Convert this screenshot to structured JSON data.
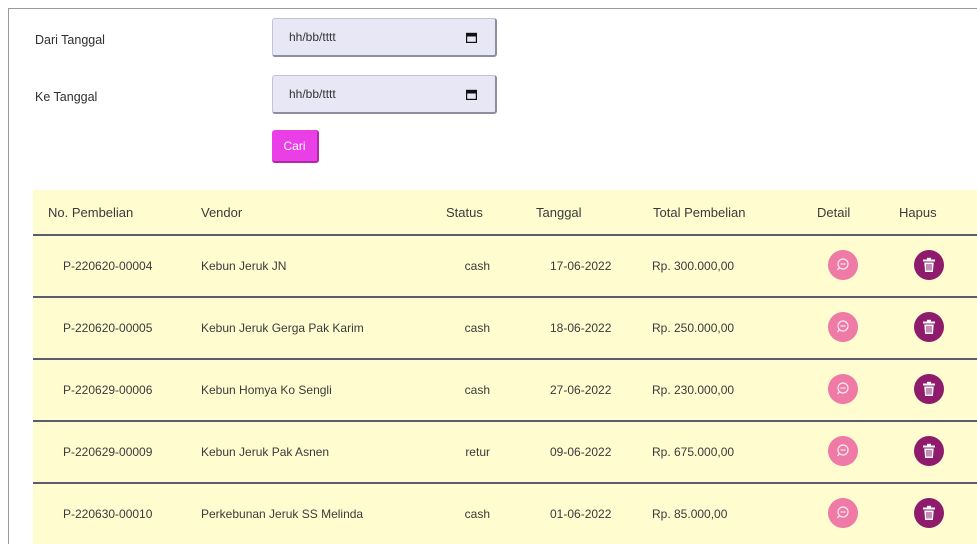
{
  "filter": {
    "from_label": "Dari Tanggal",
    "from_placeholder": "hh/bb/tttt",
    "to_label": "Ke Tanggal",
    "to_placeholder": "hh/bb/tttt",
    "search_button": "Cari"
  },
  "table": {
    "headers": {
      "no": "No. Pembelian",
      "vendor": "Vendor",
      "status": "Status",
      "tanggal": "Tanggal",
      "total": "Total Pembelian",
      "detail": "Detail",
      "hapus": "Hapus"
    },
    "rows": [
      {
        "no": "P-220620-00004",
        "vendor": "Kebun Jeruk JN",
        "status": "cash",
        "tanggal": "17-06-2022",
        "total": "Rp. 300.000,00"
      },
      {
        "no": "P-220620-00005",
        "vendor": "Kebun Jeruk Gerga Pak Karim",
        "status": "cash",
        "tanggal": "18-06-2022",
        "total": "Rp. 250.000,00"
      },
      {
        "no": "P-220629-00006",
        "vendor": "Kebun Homya Ko Sengli",
        "status": "cash",
        "tanggal": "27-06-2022",
        "total": "Rp. 230.000,00"
      },
      {
        "no": "P-220629-00009",
        "vendor": "Kebun Jeruk Pak Asnen",
        "status": "retur",
        "tanggal": "09-06-2022",
        "total": "Rp. 675.000,00"
      },
      {
        "no": "P-220630-00010",
        "vendor": "Perkebunan Jeruk SS Melinda",
        "status": "cash",
        "tanggal": "01-06-2022",
        "total": "Rp. 85.000,00"
      }
    ]
  },
  "icons": {
    "calendar": "calendar-icon",
    "detail": "zoom-out-icon",
    "delete": "trash-icon"
  },
  "colors": {
    "search_button": "#ea3fe6",
    "table_bg": "#fffdd0",
    "detail_button": "#ef7aa5",
    "delete_button": "#8e1b6c",
    "input_bg": "#e8e7f6"
  }
}
